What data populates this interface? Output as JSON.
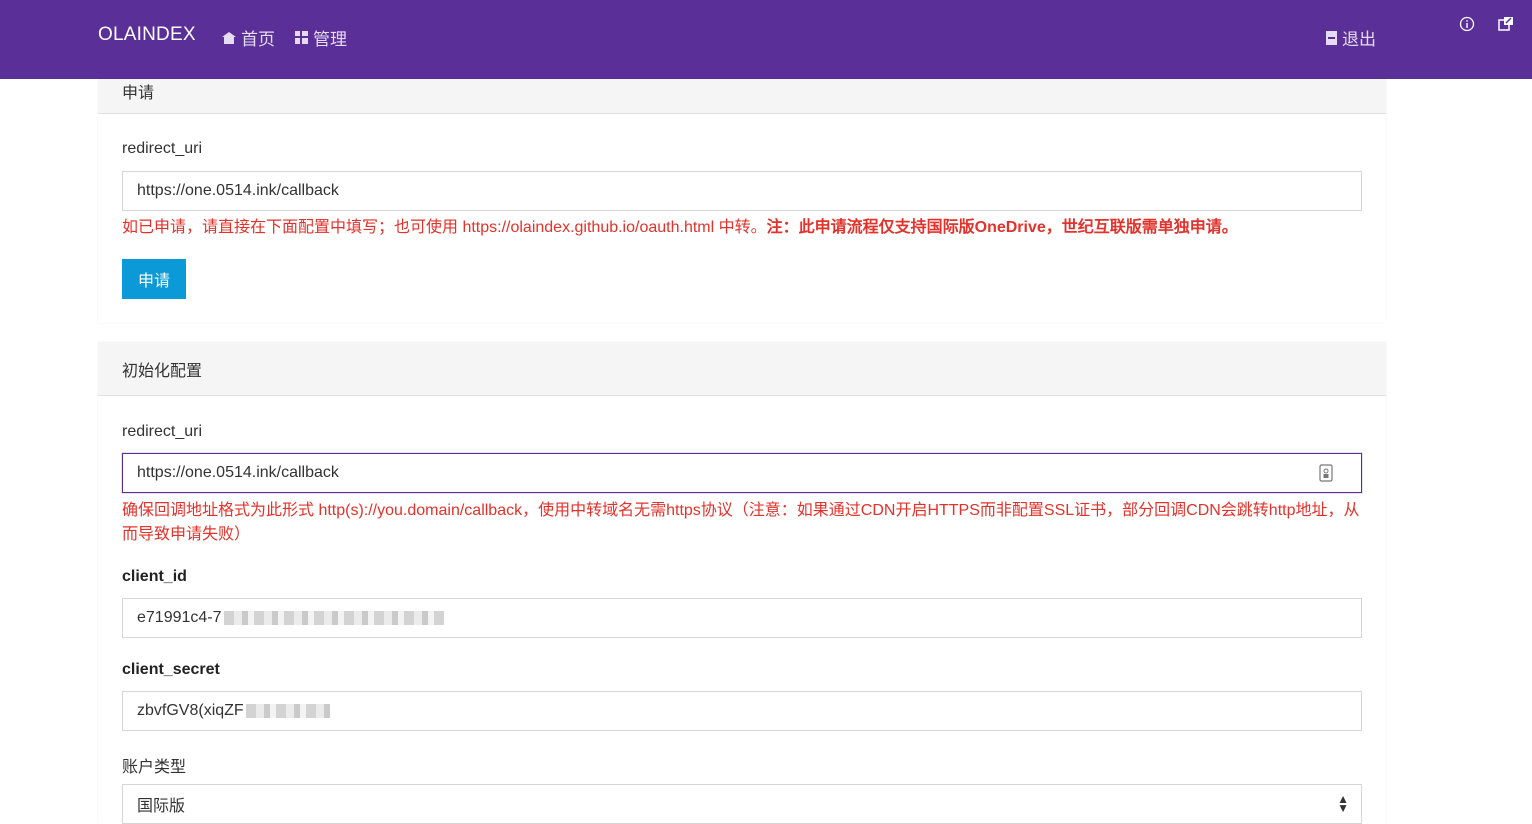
{
  "navbar": {
    "brand": "OLAINDEX",
    "home": "首页",
    "manage": "管理",
    "logout": "退出",
    "icons": {
      "home": "home-icon",
      "manage": "grid-icon",
      "logout": "door-icon",
      "info": "info-icon",
      "external": "external-icon"
    },
    "bg_color": "#5a2f98"
  },
  "apply_section": {
    "title": "申请",
    "redirect_label": "redirect_uri",
    "redirect_value": "https://one.0514.ink/callback",
    "help_text": "如已申请，请直接在下面配置中填写；也可使用 https://olaindex.github.io/oauth.html 中转。",
    "help_bold": "注：此申请流程仅支持国际版OneDrive，世纪互联版需单独申请。",
    "apply_button": "申请"
  },
  "init_section": {
    "title": "初始化配置",
    "redirect_label": "redirect_uri",
    "redirect_value": "https://one.0514.ink/callback",
    "redirect_help": "确保回调地址格式为此形式 http(s)://you.domain/callback，使用中转域名无需https协议（注意：如果通过CDN开启HTTPS而非配置SSL证书，部分回调CDN会跳转http地址，从而导致申请失败）",
    "client_id_label": "client_id",
    "client_id_value": "e71991c4-7",
    "client_secret_label": "client_secret",
    "client_secret_value": "zbvfGV8(xiqZF",
    "account_type_label": "账户类型",
    "account_type_value": "国际版"
  },
  "colors": {
    "accent": "#5a2f98",
    "button": "#0b9ad7",
    "error": "#e3322b"
  }
}
